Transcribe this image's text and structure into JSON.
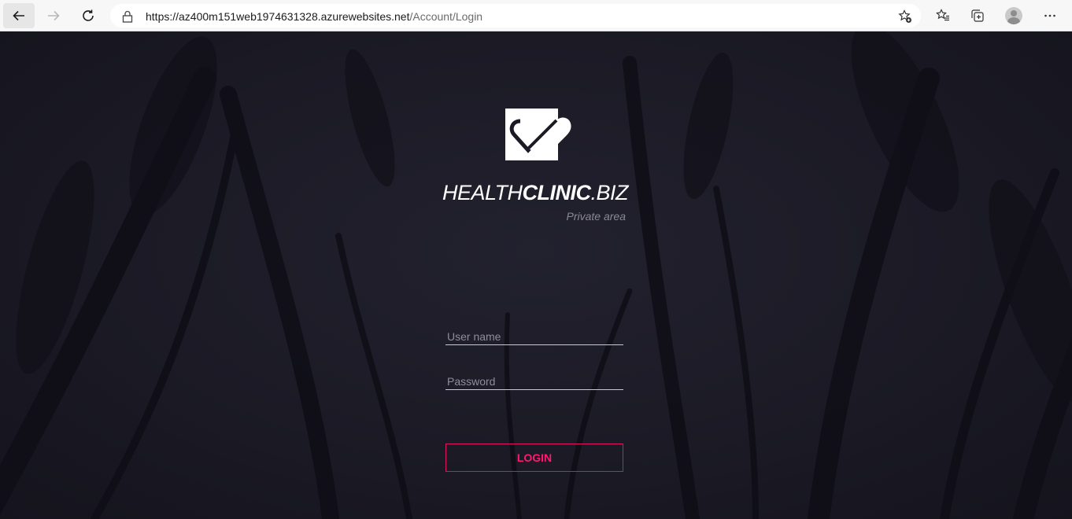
{
  "browser": {
    "url_host": "https://az400m151web1974631328.azurewebsites.net",
    "url_path": "/Account/Login"
  },
  "login": {
    "brand_light": "HEALTH",
    "brand_bold": "CLINIC",
    "brand_suffix": ".BIZ",
    "subtitle": "Private area",
    "username_placeholder": "User name",
    "password_placeholder": "Password",
    "button_label": "LOGIN"
  },
  "colors": {
    "accent": "#ff1a6b",
    "background": "#1a1a24",
    "chrome": "#f7f7f7"
  },
  "icons": [
    "back-arrow-icon",
    "forward-arrow-icon",
    "reload-icon",
    "lock-icon",
    "favorite-add-icon",
    "favorites-icon",
    "collections-icon",
    "profile-avatar-icon",
    "more-menu-icon",
    "heart-check-logo"
  ]
}
